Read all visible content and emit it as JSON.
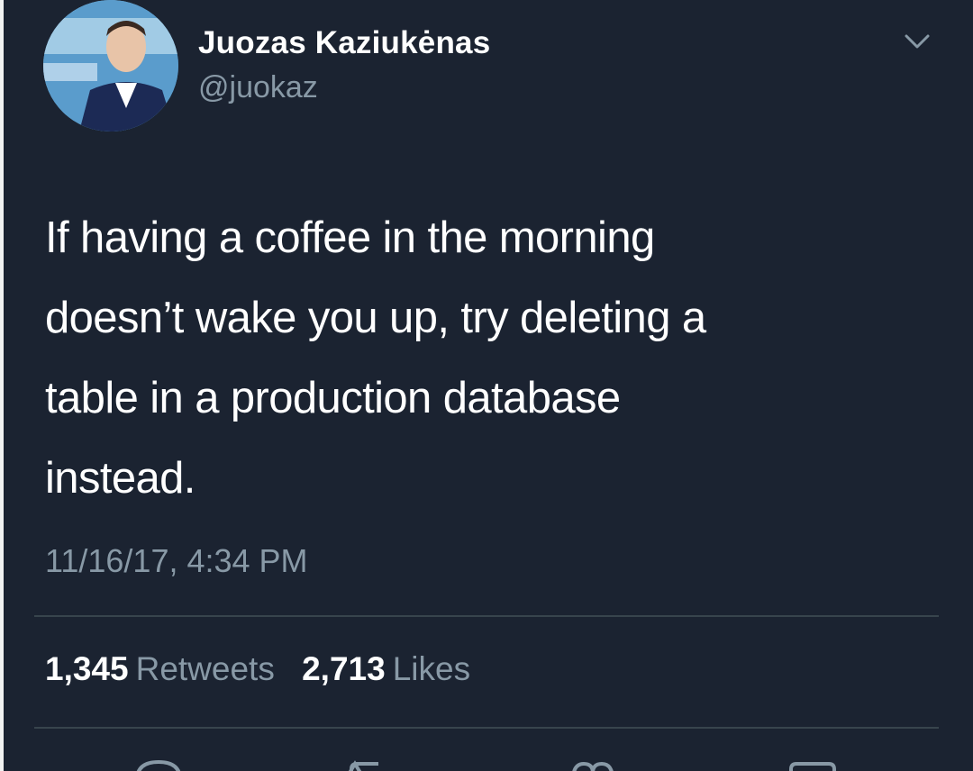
{
  "author": {
    "display_name": "Juozas Kaziukėnas",
    "handle": "@juokaz"
  },
  "tweet": {
    "lines": [
      "If having a coffee in the morning",
      "doesn’t wake you up, try deleting a",
      "table in a production database",
      "instead."
    ],
    "timestamp": "11/16/17, 4:34 PM"
  },
  "stats": {
    "retweets_count": "1,345",
    "retweets_label": "Retweets",
    "likes_count": "2,713",
    "likes_label": "Likes"
  },
  "icons": {
    "menu": "chevron-down-icon",
    "reply": "reply-icon",
    "retweet": "retweet-icon",
    "like": "heart-icon",
    "share": "share-icon"
  },
  "colors": {
    "background": "#1b2331",
    "primary_text": "#ffffff",
    "secondary_text": "#8899a6",
    "divider": "#38444d"
  }
}
